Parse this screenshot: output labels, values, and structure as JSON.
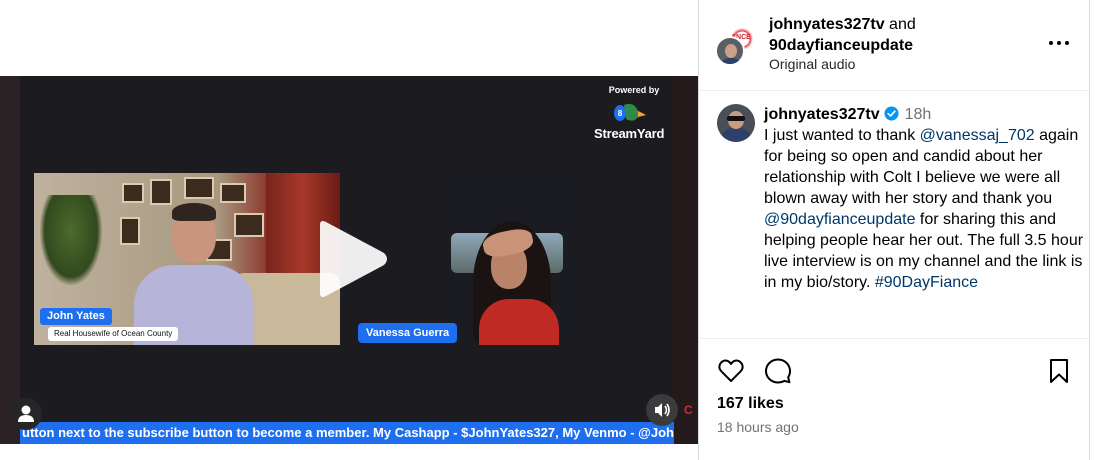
{
  "video": {
    "powered_by": "Powered by",
    "brand": "StreamYard",
    "guest1_name": "John Yates",
    "guest1_subtitle": "Real Housewife of Ocean County",
    "guest2_name": "Vanessa Guerra",
    "ticker": "utton next to the subscribe button to become a member. My Cashapp - $JohnYates327, My Venmo - @John",
    "side_marker": "C"
  },
  "post": {
    "author": "johnyates327tv",
    "and_text": " and",
    "coauthor": "90dayfianceupdate",
    "audio": "Original audio",
    "coauthor_avatar_text": "ANCE"
  },
  "caption": {
    "user": "johnyates327tv",
    "time": "18h",
    "part1": "I just wanted to thank ",
    "mention1": "@vanessaj_702",
    "part2": " again for being so open and candid about her relationship with Colt I believe we were all blown away with her story and thank you ",
    "mention2": "@90dayfianceupdate",
    "part3": " for sharing this and helping people hear her out. The full 3.5 hour live interview is on my channel and the link is in my bio/story. ",
    "hashtag": "#90DayFiance"
  },
  "stats": {
    "likes": "167 likes",
    "posted": "18 hours ago"
  },
  "colors": {
    "accent_blue": "#1e6ef0",
    "link": "#00376b",
    "verified": "#0095f6"
  }
}
